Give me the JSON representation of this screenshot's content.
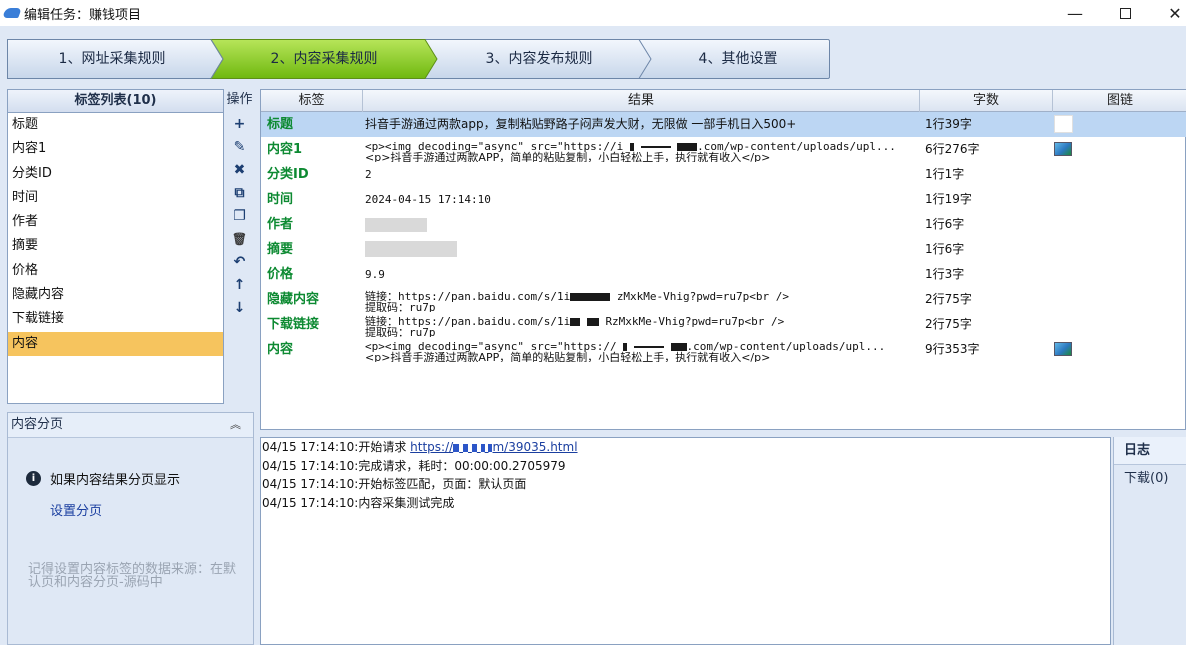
{
  "window": {
    "title": "编辑任务：赚钱项目",
    "minimize": "—"
  },
  "wizard": {
    "steps": [
      "1、网址采集规则",
      "2、内容采集规则",
      "3、内容发布规则",
      "4、其他设置"
    ],
    "active_index": 1
  },
  "tag_list": {
    "header": "标签列表(10)",
    "items": [
      "标题",
      "内容1",
      "分类ID",
      "时间",
      "作者",
      "摘要",
      "价格",
      "隐藏内容",
      "下载链接",
      "内容"
    ],
    "selected": "内容"
  },
  "ops": {
    "header": "操作",
    "icons": [
      "plus-icon",
      "edit-icon",
      "delete-icon",
      "copy-icon",
      "paste-icon",
      "trash-icon",
      "undo-icon",
      "arrow-up-icon",
      "arrow-down-icon"
    ],
    "glyphs": [
      "+",
      "✎",
      "✖",
      "⧉",
      "❐",
      "🗑",
      "↶",
      "↑",
      "↓"
    ]
  },
  "grid": {
    "columns": [
      "标签",
      "结果",
      "字数",
      "图链"
    ],
    "rows": [
      {
        "tag": "标题",
        "result1": "抖音手游通过两款app，复制粘贴野路子闷声发大财，无限做 一部手机日入500+",
        "result2": "",
        "count": "1行39字",
        "image": "white",
        "selected": true
      },
      {
        "tag": "内容1",
        "result1": "<p><img decoding=\"async\" src=\"https://i",
        "result1b": ".com/wp-content/uploads/upl...",
        "result2": "<p>抖音手游通过两款APP，简单的粘贴复制，小白轻松上手，执行就有收入</p>",
        "count": "6行276字",
        "image": "thumb"
      },
      {
        "tag": "分类ID",
        "result1": "2",
        "result2": "",
        "count": "1行1字",
        "image": ""
      },
      {
        "tag": "时间",
        "result1": "2024-04-15 17:14:10",
        "result2": "",
        "count": "1行19字",
        "image": ""
      },
      {
        "tag": "作者",
        "result1": "",
        "result2": "",
        "count": "1行6字",
        "image": ""
      },
      {
        "tag": "摘要",
        "result1": "",
        "result2": "",
        "count": "1行6字",
        "image": ""
      },
      {
        "tag": "价格",
        "result1": "9.9",
        "result2": "",
        "count": "1行3字",
        "image": ""
      },
      {
        "tag": "隐藏内容",
        "result1": "链接：https://pan.baidu.com/s/1i",
        "result1b": "zMxkMe-Vhig?pwd=ru7p<br />",
        "result2": "提取码：ru7p",
        "count": "2行75字",
        "image": ""
      },
      {
        "tag": "下载链接",
        "result1": "链接：https://pan.baidu.com/s/1i",
        "result1b": "RzMxkMe-Vhig?pwd=ru7p<br />",
        "result2": "提取码：ru7p",
        "count": "2行75字",
        "image": ""
      },
      {
        "tag": "内容",
        "result1": "<p><img decoding=\"async\" src=\"https://",
        "result1b": ".com/wp-content/uploads/upl...",
        "result2": "<p>抖音手游通过两款APP，简单的粘贴复制，小白轻松上手，执行就有收入</p>",
        "count": "9行353字",
        "image": "thumb"
      }
    ]
  },
  "paging": {
    "header": "内容分页",
    "info": "如果内容结果分页显示",
    "link": "设置分页",
    "hint": "记得设置内容标签的数据来源：在默认页和内容分页-源码中"
  },
  "log": {
    "lines": [
      {
        "text": "04/15 17:14:10:开始请求 ",
        "link": "https://",
        "link_tail": "m/39035.html"
      },
      {
        "text": "04/15 17:14:10:完成请求，耗时：00:00:00.2705979"
      },
      {
        "text": "04/15 17:14:10:开始标签匹配，页面：默认页面"
      },
      {
        "text": "04/15 17:14:10:内容采集测试完成"
      }
    ],
    "tabs": [
      "日志",
      "下载(0)"
    ]
  },
  "colors": {
    "active_step": "#8fcf1f",
    "selected_tag": "#f6c45e",
    "selected_row": "#bcd6f3",
    "tag_text": "#0d8a32"
  }
}
